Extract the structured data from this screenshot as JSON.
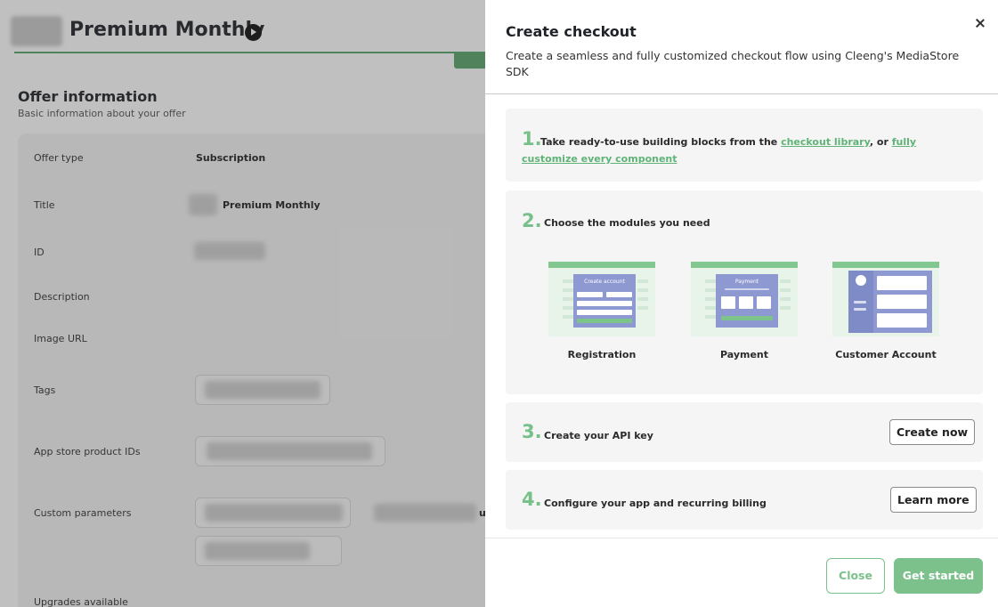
{
  "background": {
    "page_title": "Premium Monthly",
    "section_title": "Offer information",
    "section_sub": "Basic information about your offer",
    "rows": {
      "offer_type_label": "Offer type",
      "offer_type_value": "Subscription",
      "title_label": "Title",
      "title_value": "Premium Monthly",
      "id_label": "ID",
      "description_label": "Description",
      "image_url_label": "Image URL",
      "tags_label": "Tags",
      "app_store_label": "App store product IDs",
      "custom_params_label": "Custom parameters",
      "custom_params_fragment": "u",
      "upgrades_label": "Upgrades available"
    }
  },
  "drawer": {
    "title": "Create checkout",
    "subtitle": "Create a seamless and fully customized checkout flow using Cleeng's MediaStore SDK",
    "steps": [
      {
        "num": "1.",
        "text_before": "Take ready-to-use building blocks from the ",
        "link1": "checkout library",
        "text_mid": ", or ",
        "link2": "fully customize every component"
      },
      {
        "num": "2.",
        "text": "Choose the modules you need",
        "modules": [
          {
            "label": "Registration",
            "panel_title": "Create account"
          },
          {
            "label": "Payment",
            "panel_title": "Payment"
          },
          {
            "label": "Customer Account",
            "panel_title": ""
          }
        ]
      },
      {
        "num": "3.",
        "text": "Create your API key",
        "button": "Create now"
      },
      {
        "num": "4.",
        "text": "Configure your app and recurring billing",
        "button": "Learn more"
      }
    ],
    "footer": {
      "close": "Close",
      "start": "Get started"
    }
  },
  "colors": {
    "accent": "#7cc08c",
    "link": "#5fb377",
    "module_panel": "#8e99d1"
  }
}
